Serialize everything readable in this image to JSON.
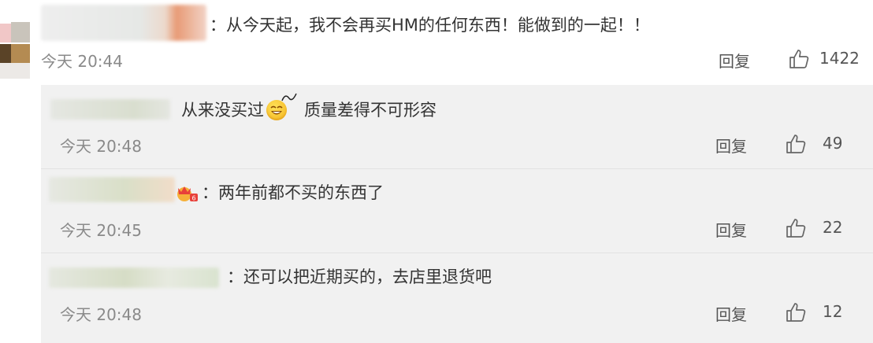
{
  "main_comment": {
    "text": "：从今天起，我不会再买HM的任何东西！能做到的一起！！",
    "time": "今天 20:44",
    "reply_label": "回复",
    "likes": "1422"
  },
  "replies": [
    {
      "text_before_emoji": "从来没买过",
      "text_after_emoji": "质量差得不可形容",
      "time": "今天 20:48",
      "reply_label": "回复",
      "likes": "49"
    },
    {
      "text": "：两年前都不买的东西了",
      "time": "今天 20:45",
      "reply_label": "回复",
      "likes": "22"
    },
    {
      "text": "：还可以把近期买的，去店里退货吧",
      "time": "今天 20:48",
      "reply_label": "回复",
      "likes": "12"
    }
  ],
  "icons": {
    "like": "thumbs-up-icon",
    "emoji": "dizzy-grin-emoji-icon",
    "badge": "crown-badge-icon"
  },
  "colors": {
    "reply_background": "#f1f1f1",
    "meta_gray": "#8a8a8a",
    "emoji_yellow": "#f3b21c",
    "crown_red": "#e8413a"
  }
}
